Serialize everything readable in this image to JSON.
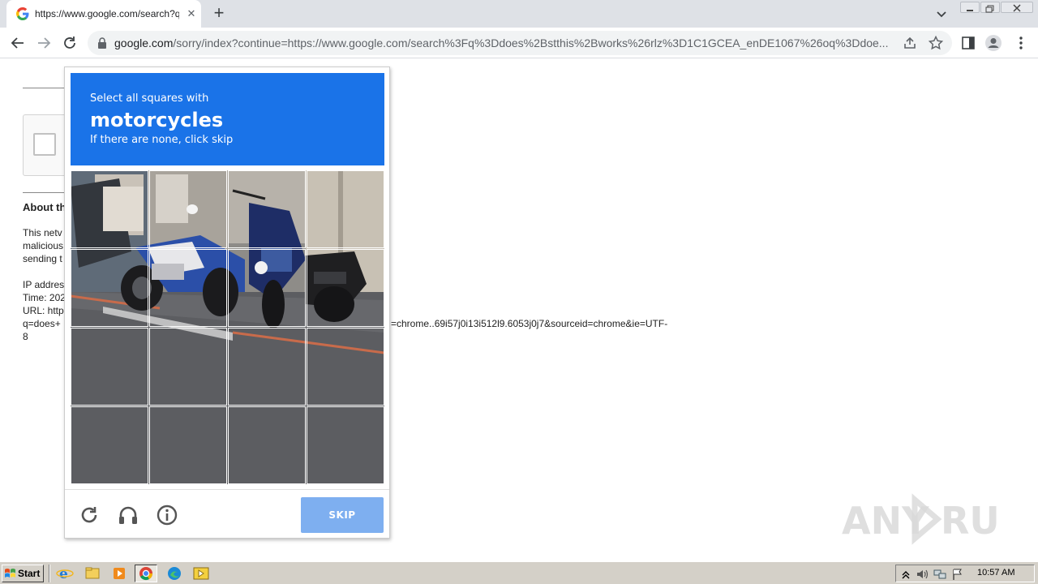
{
  "browser": {
    "tab_title": "https://www.google.com/search?q=",
    "url_domain": "google.com",
    "url_path": "/sorry/index?continue=https://www.google.com/search%3Fq%3Ddoes%2Bstthis%2Bworks%26rlz%3D1C1GCEA_enDE1067%26oq%3Ddoe..."
  },
  "page": {
    "about_heading": "About th",
    "lines": [
      "This netv",
      "malicious",
      "sending t",
      "IP addres",
      "Time: 202",
      "URL: http",
      "q=does+"
    ],
    "url_tail": "=chrome..69i57j0i13i512l9.6053j0j7&sourceid=chrome&ie=UTF-",
    "eight": "8"
  },
  "captcha": {
    "instruction_top": "Select all squares with",
    "instruction_target": "motorcycles",
    "instruction_bottom": "If there are none, click skip",
    "skip_label": "SKIP",
    "header_color": "#1a73e8",
    "skip_color": "#7eaff0"
  },
  "taskbar": {
    "start_label": "Start",
    "clock": "10:57 AM"
  },
  "watermark": "ANY.RUN"
}
